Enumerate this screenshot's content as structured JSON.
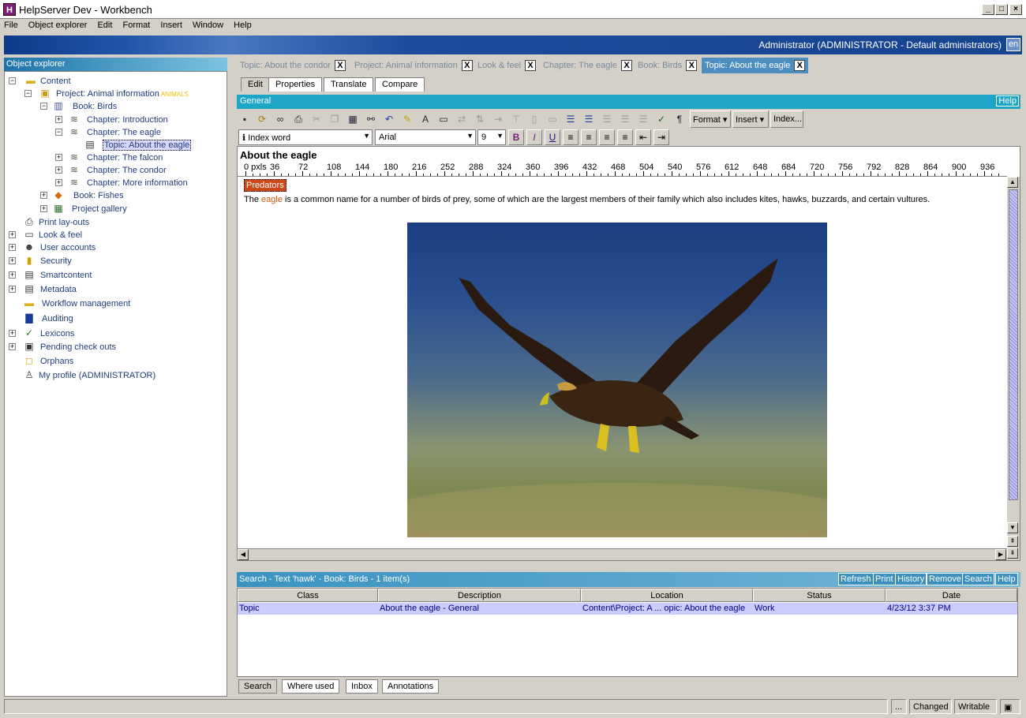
{
  "window": {
    "title": "HelpServer Dev - Workbench",
    "app_icon": "H"
  },
  "menu": [
    "File",
    "Object explorer",
    "Edit",
    "Format",
    "Insert",
    "Window",
    "Help"
  ],
  "banner": {
    "user": "Administrator (ADMINISTRATOR - Default administrators)",
    "lang": "en"
  },
  "object_explorer": {
    "title": "Object explorer",
    "tree": [
      {
        "label": "Content"
      },
      {
        "label": "Project: Animal information",
        "badge": "ANIMALS"
      },
      {
        "label": "Book: Birds"
      },
      {
        "label": "Chapter: Introduction"
      },
      {
        "label": "Chapter: The eagle"
      },
      {
        "label": "Topic: About the eagle"
      },
      {
        "label": "Chapter: The falcon"
      },
      {
        "label": "Chapter: The condor"
      },
      {
        "label": "Chapter: More information"
      },
      {
        "label": "Book: Fishes"
      },
      {
        "label": "Project gallery"
      },
      {
        "label": "Print lay-outs"
      },
      {
        "label": "Look & feel"
      },
      {
        "label": "User accounts"
      },
      {
        "label": "Security"
      },
      {
        "label": "Smartcontent"
      },
      {
        "label": "Metadata"
      },
      {
        "label": "Workflow management"
      },
      {
        "label": "Auditing"
      },
      {
        "label": "Lexicons"
      },
      {
        "label": "Pending check outs"
      },
      {
        "label": "Orphans"
      },
      {
        "label": "My profile (ADMINISTRATOR)"
      }
    ]
  },
  "doc_tabs": [
    {
      "label": "Topic: About the condor"
    },
    {
      "label": "Project: Animal information"
    },
    {
      "label": "Look & feel"
    },
    {
      "label": "Chapter: The eagle"
    },
    {
      "label": "Book: Birds"
    },
    {
      "label": "Topic: About the eagle"
    }
  ],
  "close_label": "X",
  "sub_tabs": [
    "Edit",
    "Properties",
    "Translate",
    "Compare"
  ],
  "general": {
    "title": "General",
    "help": "Help"
  },
  "toolbar": {
    "format": "Format",
    "insert": "Insert",
    "index": "Index..."
  },
  "format_bar": {
    "style": "Index word",
    "font": "Arial",
    "size": "9"
  },
  "editor": {
    "heading": "About the eagle",
    "ruler_unit": "0 pxls",
    "ruler_ticks": [
      "36",
      "72",
      "108",
      "144",
      "180",
      "216",
      "252",
      "288",
      "324",
      "360",
      "396",
      "432",
      "468",
      "504",
      "540",
      "576",
      "612",
      "648",
      "684",
      "720",
      "756",
      "792",
      "828",
      "864",
      "900",
      "936"
    ],
    "index_word": "Predators",
    "para_before": "The ",
    "para_link": "eagle",
    "para_after": " is a common name for a number of birds of prey, some of which are the largest members of their family which also includes kites, hawks, buzzards, and certain vultures."
  },
  "search": {
    "header": "Search - Text 'hawk' - Book: Birds - 1 item(s)",
    "buttons": [
      "Refresh",
      "Print",
      "History",
      "Remove",
      "Search",
      "Help"
    ],
    "columns": [
      "Class",
      "Description",
      "Location",
      "Status",
      "Date"
    ],
    "rows": [
      [
        "Topic",
        "About the eagle - General",
        "Content\\Project: A ... opic: About the eagle",
        "Work",
        "4/23/12 3:37 PM"
      ]
    ]
  },
  "bottom_tabs": [
    "Search",
    "Where used",
    "Inbox",
    "Annotations"
  ],
  "status": {
    "dots": "...",
    "changed": "Changed",
    "writable": "Writable"
  }
}
